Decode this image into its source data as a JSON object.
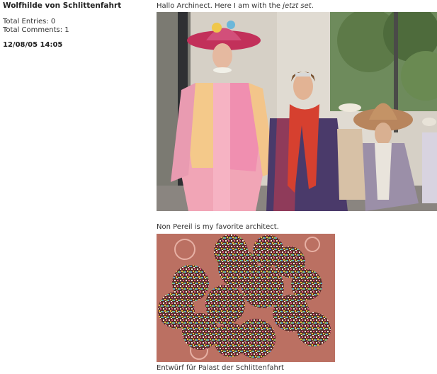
{
  "sidebar": {
    "author": "Wolfhilde von Schlittenfahrt",
    "total_entries": "Total Entries: 0",
    "total_comments": "Total Comments: 1",
    "date": "12/08/05 14:05"
  },
  "post": {
    "greeting_before": "Hallo Archinect. Here I am with the ",
    "greeting_em": "jetzt set",
    "greeting_after": ".",
    "caption_middle": "Non Pereil is my favorite architect.",
    "caption_bottom": "Entwürf für Palast der Schlittenfahrt"
  },
  "colors": {
    "text": "#333333",
    "bold_text": "#222222",
    "background": "#ffffff"
  }
}
